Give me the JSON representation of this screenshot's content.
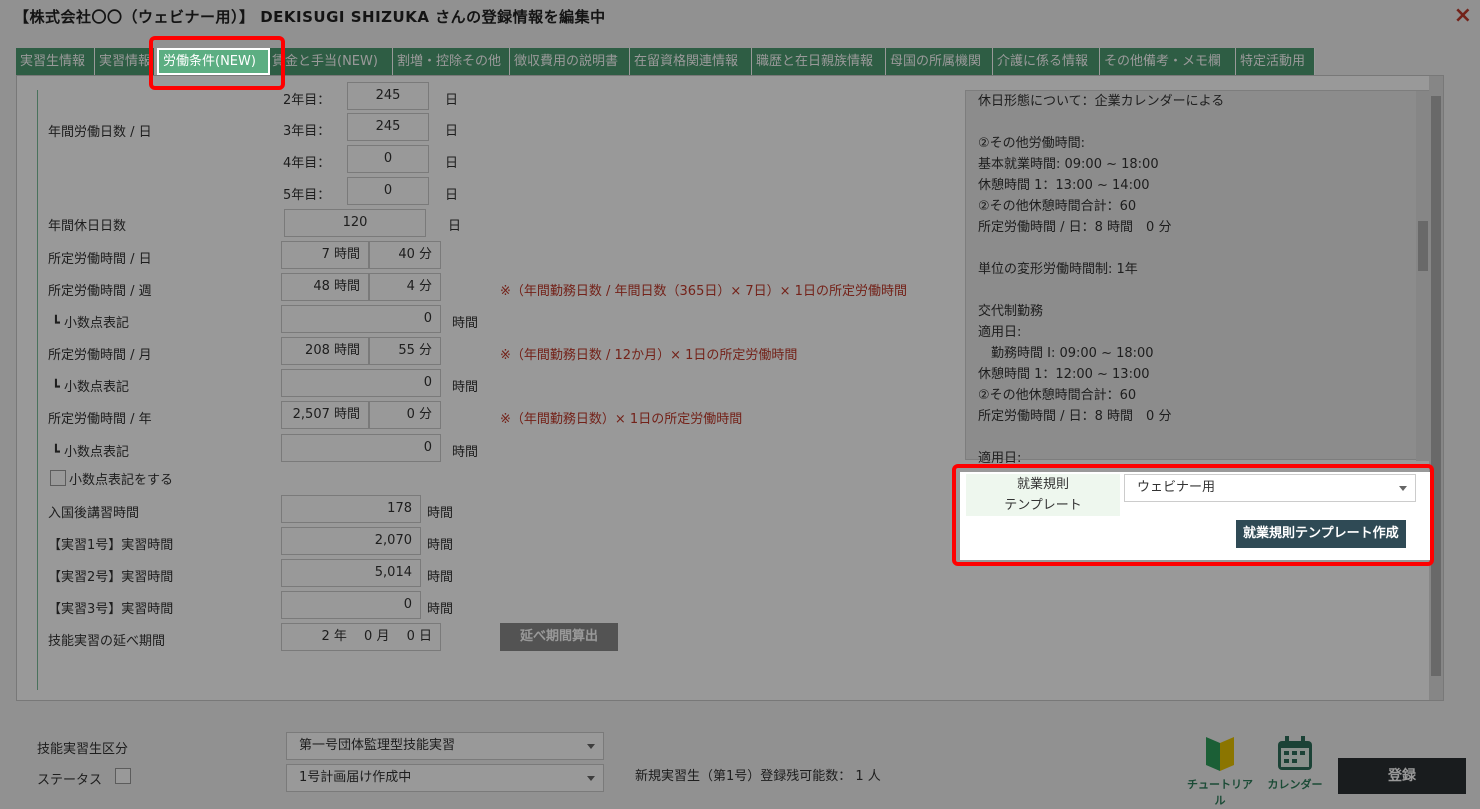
{
  "window": {
    "title": "【株式会社〇〇（ウェビナー用）】 DEKISUGI SHIZUKA さんの登録情報を編集中",
    "close_label": "×"
  },
  "tabs": [
    {
      "label": "実習生情報"
    },
    {
      "label": "実習情報"
    },
    {
      "label": "労働条件(NEW)"
    },
    {
      "label": "賃金と手当(NEW)"
    },
    {
      "label": "割増・控除その他"
    },
    {
      "label": "徴収費用の説明書"
    },
    {
      "label": "在留資格関連情報"
    },
    {
      "label": "職歴と在日親族情報"
    },
    {
      "label": "母国の所属機関"
    },
    {
      "label": "介護に係る情報"
    },
    {
      "label": "その他備考・メモ欄"
    },
    {
      "label": "特定活動用"
    }
  ],
  "form": {
    "annual_days_label": "年間労働日数 / 日",
    "years": [
      {
        "label": "2年目：",
        "value": "245",
        "unit": "日"
      },
      {
        "label": "3年目：",
        "value": "245",
        "unit": "日"
      },
      {
        "label": "4年目：",
        "value": "0",
        "unit": "日"
      },
      {
        "label": "5年目：",
        "value": "0",
        "unit": "日"
      }
    ],
    "holidays_label": "年間休日日数",
    "holidays_value": "120",
    "holidays_unit": "日",
    "daily_label": "所定労働時間 / 日",
    "daily_hours": "7 時間",
    "daily_min": "40 分",
    "weekly_label": "所定労働時間 / 週",
    "weekly_hours": "48 時間",
    "weekly_min": "4 分",
    "weekly_note": "※（年間勤務日数 / 年間日数（365日）× 7日）× 1日の所定労働時間",
    "decimal_label": "┗ 小数点表記",
    "weekly_decimal": "0",
    "hours_unit": "時間",
    "monthly_label": "所定労働時間 / 月",
    "monthly_hours": "208 時間",
    "monthly_min": "55 分",
    "monthly_note": "※（年間勤務日数 / 12か月）× 1日の所定労働時間",
    "monthly_decimal": "0",
    "yearly_label": "所定労働時間 / 年",
    "yearly_hours": "2,507 時間",
    "yearly_min": "0 分",
    "yearly_note": "※（年間勤務日数）× 1日の所定労働時間",
    "yearly_decimal": "0",
    "decimal_check_label": "小数点表記をする",
    "training_rows": [
      {
        "label": "入国後講習時間",
        "value": "178",
        "unit": "時間"
      },
      {
        "label": "【実習1号】実習時間",
        "value": "2,070",
        "unit": "時間"
      },
      {
        "label": "【実習2号】実習時間",
        "value": "5,014",
        "unit": "時間"
      },
      {
        "label": "【実習3号】実習時間",
        "value": "0",
        "unit": "時間"
      }
    ],
    "period_label": "技能実習の延べ期間",
    "period_value": "2 年　 0 月　 0 日",
    "period_button": "延べ期間算出"
  },
  "work_rules_text": [
    "休日形態について：企業カレンダーによる",
    "",
    "②その他労働時間:",
    "基本就業時間: 09:00 ~ 18:00",
    "休憩時間 1：13:00 ~ 14:00",
    "②その他休憩時間合計：60",
    "所定労働時間 / 日：8 時間　0 分",
    "",
    "単位の変形労働時間制: 1年",
    "",
    "交代制勤務",
    "適用日:",
    "　勤務時間 I: 09:00 ~ 18:00",
    "休憩時間 1：12:00 ~ 13:00",
    "②その他休憩時間合計：60",
    "所定労働時間 / 日：8 時間　0 分",
    "",
    "適用日:"
  ],
  "template": {
    "label_line1": "就業規則",
    "label_line2": "テンプレート",
    "selected": "ウェビナー用",
    "create_button": "就業規則テンプレート作成"
  },
  "bottom": {
    "category_label": "技能実習生区分",
    "category_value": "第一号団体監理型技能実習",
    "status_label": "ステータス",
    "status_value": "1号計画届け作成中",
    "remaining_text": "新規実習生（第1号）登録残可能数： 1 人",
    "tutorial_label": "チュートリアル",
    "calendar_label": "カレンダー",
    "submit_label": "登録"
  }
}
